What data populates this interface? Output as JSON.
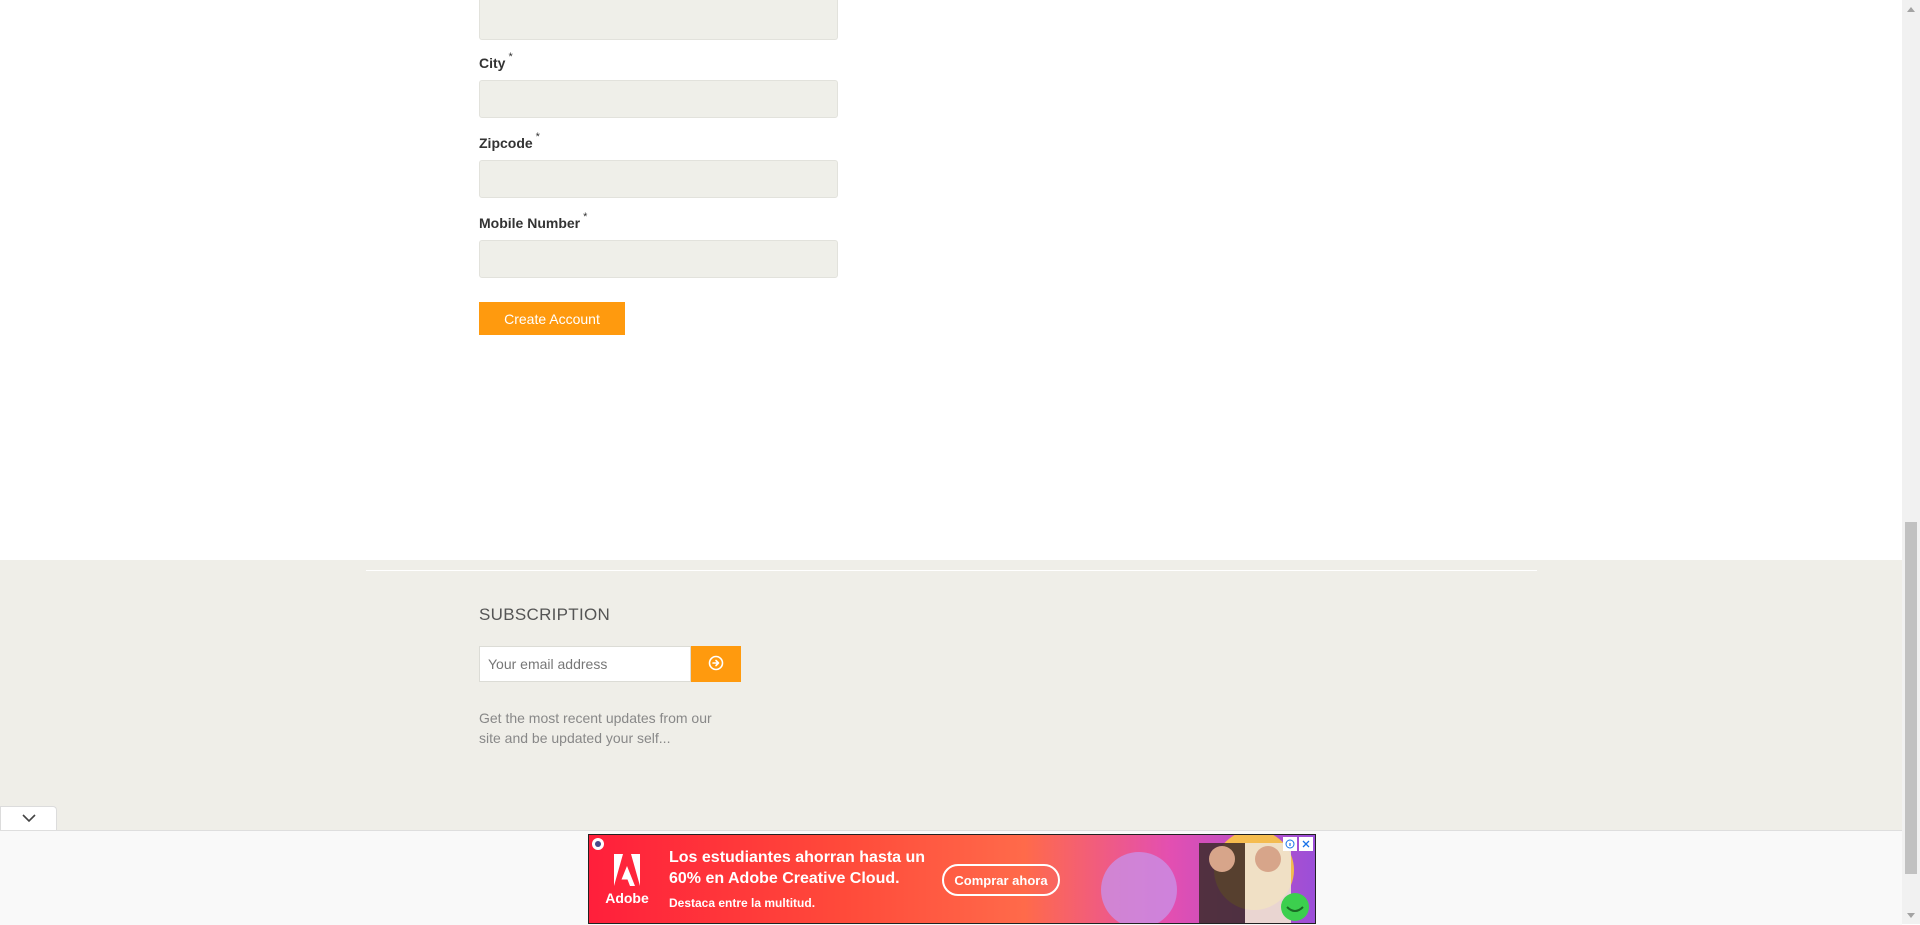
{
  "form": {
    "fields": [
      {
        "label": "City",
        "required": "*"
      },
      {
        "label": "Zipcode",
        "required": "*"
      },
      {
        "label": "Mobile Number",
        "required": "*"
      }
    ],
    "submit_label": "Create Account"
  },
  "footer": {
    "subscription_title": "SUBSCRIPTION",
    "email_placeholder": "Your email address",
    "description": "Get the most recent updates from our site and be updated your self..."
  },
  "ad": {
    "brand": "Adobe",
    "headline": "Los estudiantes ahorran hasta un 60% en Adobe Creative Cloud.",
    "subline": "Destaca entre la multitud.",
    "cta": "Comprar ahora"
  },
  "colors": {
    "accent": "#ff9a0e",
    "footer_bg": "#efeee8",
    "field_bg": "#efefe9"
  },
  "icons": {
    "subscribe": "arrow-circle-right-icon",
    "collapse": "chevron-down-icon",
    "ad_close": "close-icon",
    "ad_info": "info-icon"
  }
}
